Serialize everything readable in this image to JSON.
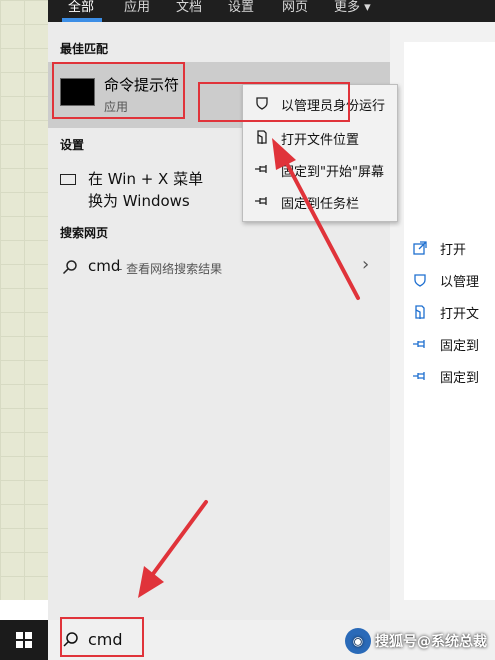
{
  "tabs": [
    "全部",
    "应用",
    "文档",
    "设置",
    "网页",
    "更多"
  ],
  "best_match": {
    "section": "最佳匹配",
    "title": "命令提示符",
    "subtitle": "应用"
  },
  "settings": {
    "section": "设置",
    "line1": "在 Win + X 菜单",
    "line2": "换为 Windows"
  },
  "web": {
    "section": "搜索网页",
    "query": "cmd",
    "suffix": " - 查看网络搜索结果"
  },
  "context_menu": [
    {
      "label": "以管理员身份运行",
      "icon": "shield-icon"
    },
    {
      "label": "打开文件位置",
      "icon": "file-location-icon"
    },
    {
      "label": "固定到\"开始\"屏幕",
      "icon": "pin-icon"
    },
    {
      "label": "固定到任务栏",
      "icon": "pin-icon"
    }
  ],
  "right_actions": [
    {
      "label": "打开",
      "icon": "open-icon"
    },
    {
      "label": "以管理",
      "icon": "shield-icon"
    },
    {
      "label": "打开文",
      "icon": "file-location-icon"
    },
    {
      "label": "固定到",
      "icon": "pin-icon"
    },
    {
      "label": "固定到",
      "icon": "pin-icon"
    }
  ],
  "taskbar": {
    "search_value": "cmd",
    "watermark": "搜狐号@系统总裁"
  },
  "colors": {
    "highlight": "#e0333a",
    "accent": "#3c8ee6",
    "icon_blue": "#1e6fd0"
  }
}
